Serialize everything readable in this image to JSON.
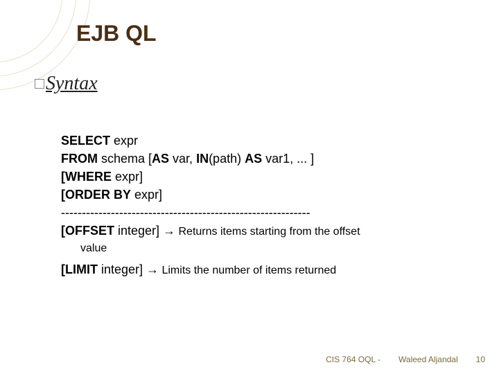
{
  "title": "EJB QL",
  "subhead": {
    "label": "Syntax"
  },
  "syntax": {
    "select_kw": "SELECT",
    "select_rest": " expr",
    "from_kw": "FROM",
    "from_rest_1": " schema [",
    "from_as": "AS",
    "from_rest_2": " var, ",
    "from_in": "IN",
    "from_rest_3": "(path) ",
    "from_as2": "AS",
    "from_rest_4": " var1, ... ]",
    "where_kw": "[WHERE",
    "where_rest": " expr]",
    "order_kw": "[ORDER BY",
    "order_rest": " expr]",
    "dashes": "------------------------------------------------------------",
    "offset_kw": "[OFFSET",
    "offset_mid": " integer]   ",
    "offset_arrow": "→",
    "offset_desc": " Returns items starting from the offset",
    "offset_desc2": "value",
    "limit_kw": "[LIMIT",
    "limit_mid": " integer]   ",
    "limit_arrow": "→",
    "limit_desc": " Limits the number of items returned"
  },
  "footer": {
    "left": "CIS 764 OQL -",
    "right": "Waleed Aljandal",
    "page": "10"
  }
}
